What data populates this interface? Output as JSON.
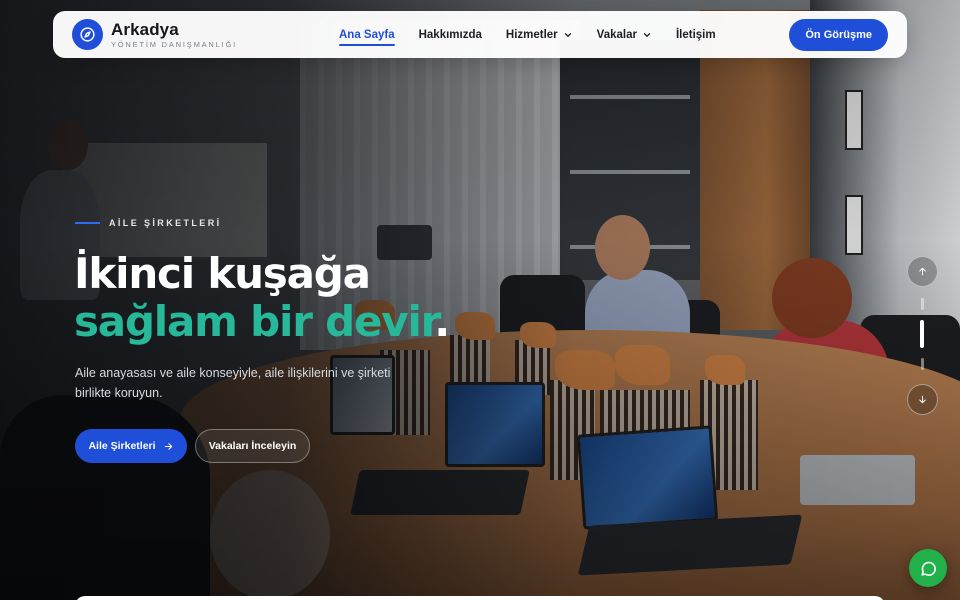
{
  "brand": {
    "name": "Arkadya",
    "tagline": "YÖNETİM DANIŞMANLIĞI",
    "logo_icon": "compass-icon",
    "accent_color": "#1f4fd8"
  },
  "nav": {
    "items": [
      {
        "label": "Ana Sayfa",
        "active": true,
        "dropdown": false
      },
      {
        "label": "Hakkımızda",
        "active": false,
        "dropdown": false
      },
      {
        "label": "Hizmetler",
        "active": false,
        "dropdown": true
      },
      {
        "label": "Vakalar",
        "active": false,
        "dropdown": true
      },
      {
        "label": "İletişim",
        "active": false,
        "dropdown": false
      }
    ],
    "cta_label": "Ön Görüşme"
  },
  "hero": {
    "eyebrow": "AİLE ŞİRKETLERİ",
    "title_line1": "İkinci kuşağa",
    "title_line2": "sağlam bir devir",
    "title_dot": ".",
    "highlight_color": "#27b89a",
    "lead": "Aile anayasası ve aile konseyiyle, aile ilişkilerini ve şirketi birlikte koruyun.",
    "primary_button": "Aile Şirketleri",
    "primary_icon": "arrow-right-icon",
    "secondary_button": "Vakaları İnceleyin"
  },
  "slider": {
    "prev_icon": "arrow-up-icon",
    "next_icon": "arrow-down-icon",
    "slide_count": 3,
    "active_slide": 2
  },
  "chat": {
    "icon": "whatsapp-icon",
    "color": "#22b04b"
  }
}
